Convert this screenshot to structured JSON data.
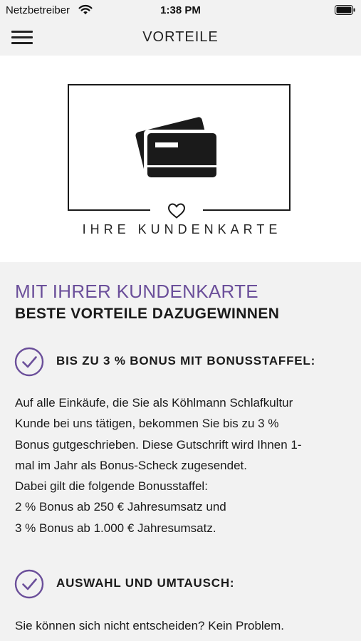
{
  "status_bar": {
    "carrier": "Netzbetreiber",
    "time": "1:38 PM",
    "icons": [
      "wifi-icon",
      "battery-icon"
    ]
  },
  "nav": {
    "title": "VORTEILE",
    "menu_icon": "hamburger-menu-icon"
  },
  "hero": {
    "icon": "credit-card-icon",
    "heart_icon": "heart-icon",
    "caption": "IHRE KUNDENKARTE"
  },
  "content": {
    "headline": "MIT IHRER KUNDENKARTE",
    "subheadline": "BESTE VORTEILE DAZUGEWINNEN",
    "benefits": [
      {
        "icon": "check-circle-icon",
        "title": "BIS ZU 3 % BONUS MIT BONUSSTAFFEL:",
        "lines": [
          "Auf alle Einkäufe, die Sie als Köhlmann Schlafkultur",
          "Kunde bei uns tätigen, bekommen Sie bis zu 3 %",
          "Bonus gutgeschrieben. Diese Gutschrift wird Ihnen 1-",
          "mal im Jahr als Bonus-Scheck zugesendet.",
          "Dabei gilt die folgende Bonusstaffel:",
          "2 % Bonus ab 250 € Jahresumsatz und",
          "3 % Bonus ab 1.000 € Jahresumsatz."
        ]
      },
      {
        "icon": "check-circle-icon",
        "title": "AUSWAHL UND UMTAUSCH:",
        "lines": [
          "Sie können sich nicht entscheiden? Kein Problem."
        ]
      }
    ]
  },
  "colors": {
    "accent": "#6b4f9a",
    "background": "#f2f2f2",
    "hero_background": "#ffffff",
    "text": "#1a1a1a"
  }
}
